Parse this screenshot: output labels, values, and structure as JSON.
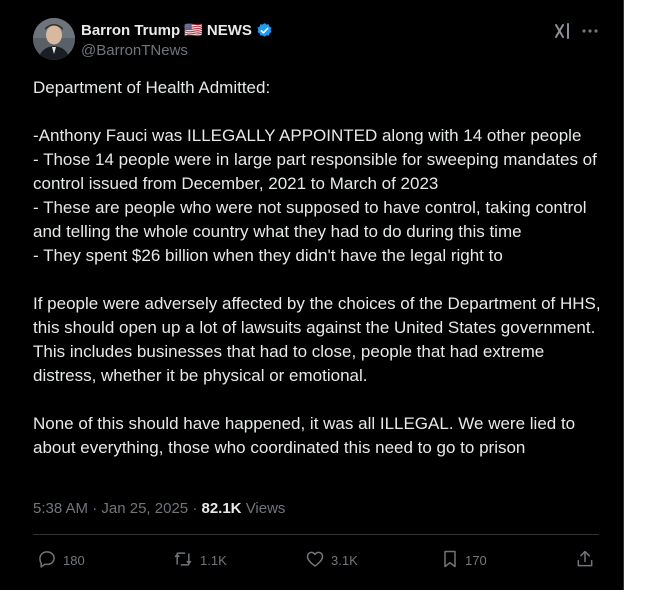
{
  "post": {
    "author_name": "Barron Trump",
    "author_flag": "🇺🇸",
    "author_suffix": "NEWS",
    "handle": "@BarronTNews",
    "verified": true,
    "icons": {
      "grok": "grok-icon",
      "more": "more-icon",
      "verified": "verified-badge-icon"
    },
    "body": [
      "Department of Health Admitted:",
      "",
      "-Anthony Fauci was ILLEGALLY APPOINTED along with 14 other people",
      "- Those 14 people were in large part responsible for sweeping mandates of control issued from December, 2021 to March of 2023",
      "- These are people who were not supposed to have control, taking control and telling the whole country what they had to do during this time",
      "- They spent $26 billion when they didn't have the legal right to",
      "",
      "If people were adversely affected by the choices of the Department of HHS, this should open up a lot of lawsuits against the United States government. This includes businesses that had to close, people that had extreme distress, whether it be physical or emotional.",
      "",
      "None of this should have happened, it was all ILLEGAL. We were lied to about everything, those who coordinated this need to go to prison"
    ],
    "time": "5:38 AM",
    "separator": "·",
    "date": "Jan 25, 2025",
    "views_count": "82.1K",
    "views_label": "Views",
    "actions": {
      "replies": "180",
      "reposts": "1.1K",
      "likes": "3.1K",
      "bookmarks": "170"
    }
  },
  "colors": {
    "background": "#000000",
    "text": "#e7e9ea",
    "secondary": "#71767b",
    "verified": "#1d9bf0",
    "divider": "#2f3336"
  }
}
